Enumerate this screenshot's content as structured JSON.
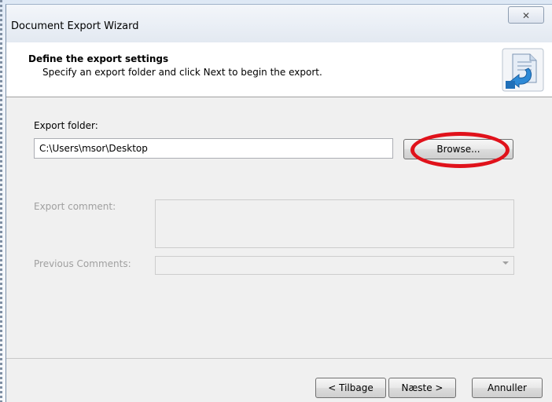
{
  "window": {
    "title": "Document Export Wizard",
    "close_glyph": "✕"
  },
  "header": {
    "title": "Define the export settings",
    "subtitle": "Specify an export folder and click Next to begin the export.",
    "icon": "export-document-icon"
  },
  "form": {
    "export_folder_label": "Export folder:",
    "export_folder_value": "C:\\Users\\msor\\Desktop",
    "browse_label": "Browse...",
    "export_comment_label": "Export comment:",
    "export_comment_value": "",
    "previous_comments_label": "Previous Comments:",
    "previous_comments_value": ""
  },
  "footer": {
    "back_label": "< Tilbage",
    "next_label": "Næste >",
    "cancel_label": "Annuller"
  },
  "colors": {
    "highlight_ring": "#e0121b",
    "dialog_bg": "#f0f0f0",
    "disabled_text": "#a0a0a0"
  }
}
